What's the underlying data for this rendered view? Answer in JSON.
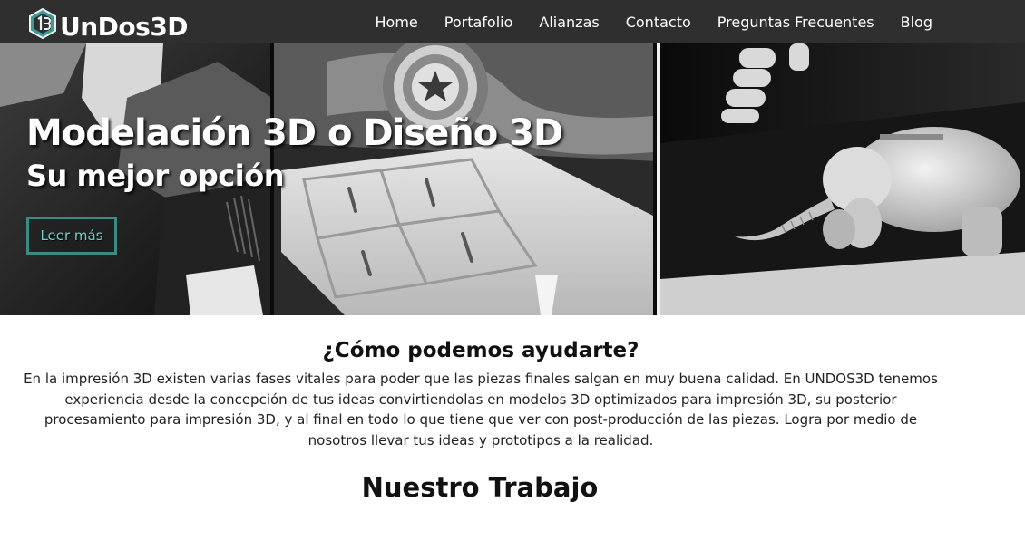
{
  "brand": {
    "name": "UnDos3D",
    "logo_icon": "cube-logo-icon",
    "accent": "#3a8a86"
  },
  "nav": {
    "items": [
      {
        "label": "Home"
      },
      {
        "label": "Portafolio"
      },
      {
        "label": "Alianzas"
      },
      {
        "label": "Contacto"
      },
      {
        "label": "Preguntas Frecuentes"
      },
      {
        "label": "Blog"
      }
    ]
  },
  "hero": {
    "title": "Modelación 3D o Diseño 3D",
    "subtitle": "Su mejor opción",
    "button_label": "Leer más",
    "button_color": "#6fd0ca"
  },
  "help": {
    "title": "¿Cómo podemos ayudarte?",
    "text": "En la impresión 3D existen varias fases vitales para poder que las piezas finales salgan en muy buena calidad. En UNDOS3D tenemos experiencia desde la concepción de tus ideas convirtiendolas en modelos 3D optimizados para impresión 3D, su posterior procesamiento para impresión 3D, y al final en todo lo que tiene que ver con post-producción de las piezas. Logra por medio de nosotros llevar tus ideas y prototipos a la realidad."
  },
  "work": {
    "title": "Nuestro Trabajo"
  }
}
